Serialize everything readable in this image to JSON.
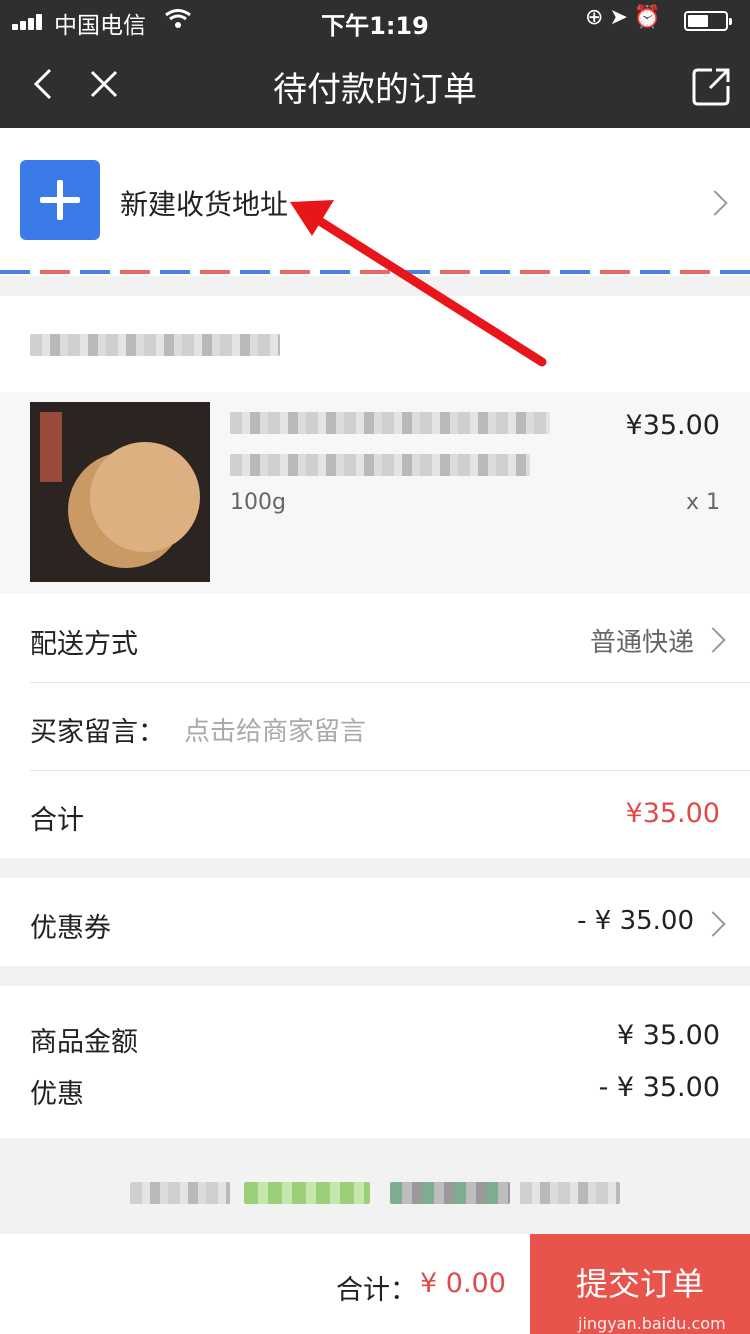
{
  "status_bar": {
    "carrier": "中国电信",
    "time": "下午1:19"
  },
  "nav": {
    "title": "待付款的订单"
  },
  "address": {
    "label": "新建收货地址"
  },
  "product": {
    "price": "¥35.00",
    "spec": "100g",
    "quantity": "x 1"
  },
  "delivery": {
    "label": "配送方式",
    "value": "普通快递"
  },
  "message": {
    "label": "买家留言：",
    "placeholder": "点击给商家留言"
  },
  "subtotal": {
    "label": "合计",
    "value": "¥35.00"
  },
  "coupon": {
    "label": "优惠券",
    "value": "- ¥ 35.00"
  },
  "amounts": {
    "goods_label": "商品金额",
    "goods_value": "¥ 35.00",
    "discount_label": "优惠",
    "discount_value": "- ¥ 35.00"
  },
  "footer": {
    "total_label": "合计：",
    "total_value": "¥ 0.00",
    "submit_label": "提交订单",
    "watermark": "jingyan.baidu.com"
  },
  "colors": {
    "accent_blue": "#3b7be8",
    "price_red": "#e24a4a",
    "submit_red": "#e8534c",
    "nav_dark": "#2f2f2f"
  },
  "icons": [
    "back-icon",
    "close-icon",
    "share-icon",
    "plus-icon",
    "chevron-right-icon",
    "wifi-icon",
    "battery-icon",
    "alarm-icon",
    "location-icon"
  ]
}
